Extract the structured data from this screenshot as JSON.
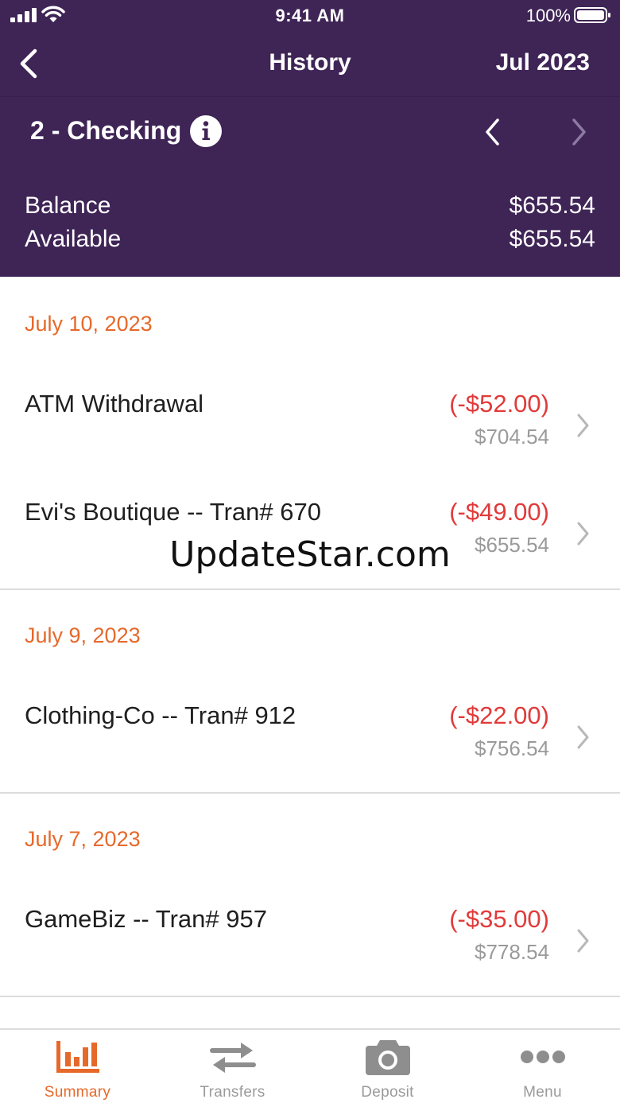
{
  "status_bar": {
    "time": "9:41 AM",
    "battery": "100%"
  },
  "nav": {
    "title": "History",
    "month": "Jul 2023"
  },
  "account": {
    "name": "2 - Checking"
  },
  "balances": [
    {
      "label": "Balance",
      "value": "$655.54"
    },
    {
      "label": "Available",
      "value": "$655.54"
    }
  ],
  "groups": [
    {
      "date": "July 10, 2023",
      "transactions": [
        {
          "name": "ATM Withdrawal",
          "amount": "(-$52.00)",
          "balance": "$704.54"
        },
        {
          "name": "Evi's Boutique -- Tran# 670",
          "amount": "(-$49.00)",
          "balance": "$655.54"
        }
      ]
    },
    {
      "date": "July 9, 2023",
      "transactions": [
        {
          "name": "Clothing-Co -- Tran# 912",
          "amount": "(-$22.00)",
          "balance": "$756.54"
        }
      ]
    },
    {
      "date": "July 7, 2023",
      "transactions": [
        {
          "name": "GameBiz -- Tran# 957",
          "amount": "(-$35.00)",
          "balance": "$778.54"
        }
      ]
    }
  ],
  "watermark": "UpdateStar.com",
  "tabbar": {
    "active": "Summary",
    "tabs": [
      {
        "label": "Summary",
        "icon": "bar-chart-icon"
      },
      {
        "label": "Transfers",
        "icon": "transfer-arrows-icon"
      },
      {
        "label": "Deposit",
        "icon": "camera-icon"
      },
      {
        "label": "Menu",
        "icon": "more-dots-icon"
      }
    ]
  },
  "colors": {
    "header_bg": "#3f2456",
    "accent": "#e6692b",
    "debit": "#e23a3a",
    "muted": "#9a9a9a",
    "tab_inactive": "#9a9a9a"
  }
}
